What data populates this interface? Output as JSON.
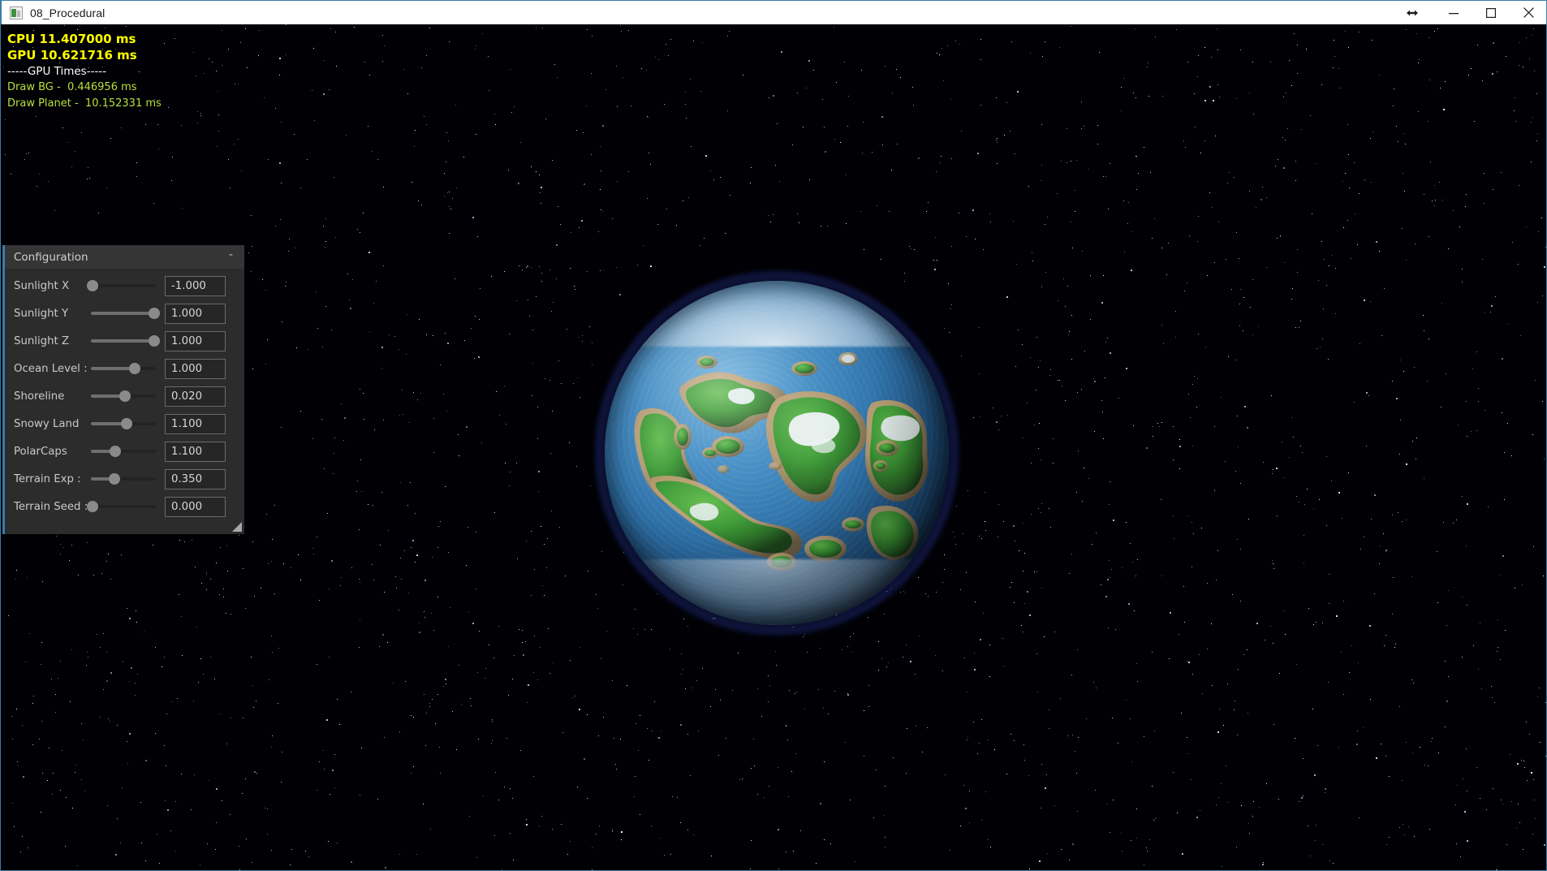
{
  "window": {
    "title": "08_Procedural",
    "icon": "app-window-icon",
    "controls": [
      {
        "name": "resize-arrow",
        "glyph": "horizontal-double-arrow-icon"
      },
      {
        "name": "minimize",
        "glyph": "minimize-icon"
      },
      {
        "name": "maximize",
        "glyph": "maximize-icon"
      },
      {
        "name": "close",
        "glyph": "close-icon"
      }
    ],
    "accent_color": "#3a7ca8",
    "titlebar_bg": "#ffffff"
  },
  "stats_overlay": {
    "cpu_line": "CPU 11.407000 ms",
    "gpu_line": "GPU 10.621716 ms",
    "gpu_times_header": "-----GPU Times-----",
    "entries": [
      "Draw BG -  0.446956 ms",
      "Draw Planet -  10.152331 ms"
    ],
    "colors": {
      "primary": "#ffff00",
      "header": "#ffffff",
      "entry": "#b9e03c"
    }
  },
  "config_panel": {
    "title": "Configuration",
    "collapse_label": "-",
    "accent_color": "#3a7ca8",
    "background": "#2c2c2c",
    "rows": [
      {
        "label": "Sunlight X",
        "value": "-1.000",
        "fill_pct": 2
      },
      {
        "label": "Sunlight Y",
        "value": "1.000",
        "fill_pct": 98
      },
      {
        "label": "Sunlight Z",
        "value": "1.000",
        "fill_pct": 98
      },
      {
        "label": "Ocean Level :",
        "value": "1.000",
        "fill_pct": 68
      },
      {
        "label": "Shoreline",
        "value": "0.020",
        "fill_pct": 52
      },
      {
        "label": "Snowy Land",
        "value": "1.100",
        "fill_pct": 55
      },
      {
        "label": "PolarCaps",
        "value": "1.100",
        "fill_pct": 38
      },
      {
        "label": "Terrain Exp :",
        "value": "0.350",
        "fill_pct": 36
      },
      {
        "label": "Terrain Seed :",
        "value": "0.000",
        "fill_pct": 3
      }
    ],
    "resize_grip": "resize-grip-icon"
  },
  "scene": {
    "description": "procedurally generated planet rendered over a starfield",
    "ocean_color": "#3c87c0",
    "land_color": "#3e9c37",
    "sand_color": "#b79a6d",
    "snow_color": "#eef2f6",
    "atmosphere_color": "#4a5fe0",
    "space_color": "#000005"
  }
}
